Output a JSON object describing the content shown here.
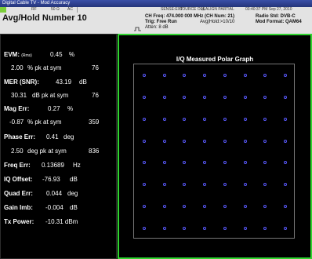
{
  "window": {
    "title": "Digital Cable TV - Mod Accuracy"
  },
  "status_bar": {
    "rf_label": "RF",
    "impedance": "50 Ω",
    "coupling": "AC",
    "sense": "SENSE:EXT",
    "source": "SOURCE OFF",
    "alert": "ALIGN PARTIAL",
    "timestamp": "03:40:37 PM Sep 27, 2010"
  },
  "header": {
    "mode_title": "Avg/Hold Number  10",
    "ch_freq": "CH Freq: 474.000 000 MHz (CH Num: 21)",
    "trig": "Trig: Free Run",
    "avg_hold": "Avg|Hold:>10/10",
    "atten": "Atten: 8 dB",
    "radio_std": "Radio Std: DVB-C",
    "mod_format": "Mod Format: QAM64"
  },
  "metrics": {
    "evm": {
      "label": "EVM:",
      "qualifier": "(Rms)",
      "value": "0.45",
      "unit": "%",
      "pk_value": "2.00",
      "pk_text": "% pk at sym",
      "pk_sym": "76"
    },
    "mer": {
      "label": "MER (SNR):",
      "value": "43.19",
      "unit": "dB",
      "pk_value": "30.31",
      "pk_text": "dB pk at sym",
      "pk_sym": "76"
    },
    "mag_err": {
      "label": "Mag Err:",
      "value": "0.27",
      "unit": "%",
      "pk_value": "-0.87",
      "pk_text": "% pk at sym",
      "pk_sym": "359"
    },
    "phase_err": {
      "label": "Phase Err:",
      "value": "0.41",
      "unit": "deg",
      "pk_value": "2.50",
      "pk_text": "deg pk at sym",
      "pk_sym": "836"
    },
    "freq_err": {
      "label": "Freq Err:",
      "value": "0.13689",
      "unit": "Hz"
    },
    "iq_offset": {
      "label": "IQ Offset:",
      "value": "-76.93",
      "unit": "dB"
    },
    "quad_err": {
      "label": "Quad Err:",
      "value": "0.044",
      "unit": "deg"
    },
    "gain_imb": {
      "label": "Gain Imb:",
      "value": "-0.004",
      "unit": "dB"
    },
    "tx_power": {
      "label": "Tx Power:",
      "value": "-10.31 dBm"
    }
  },
  "graph": {
    "title": "I/Q Measured Polar Graph",
    "dot_color": "#5a5aff",
    "frame_color": "#2fd52f"
  },
  "chart_data": {
    "type": "scatter",
    "title": "I/Q Measured Polar Graph",
    "description_grid": "8x8 QAM64 constellation",
    "x": [
      -7,
      -5,
      -3,
      -1,
      1,
      3,
      5,
      7
    ],
    "y": [
      7,
      5,
      3,
      1,
      -1,
      -3,
      -5,
      -7
    ],
    "xlim": [
      -8,
      8
    ],
    "ylim": [
      -8,
      8
    ]
  }
}
